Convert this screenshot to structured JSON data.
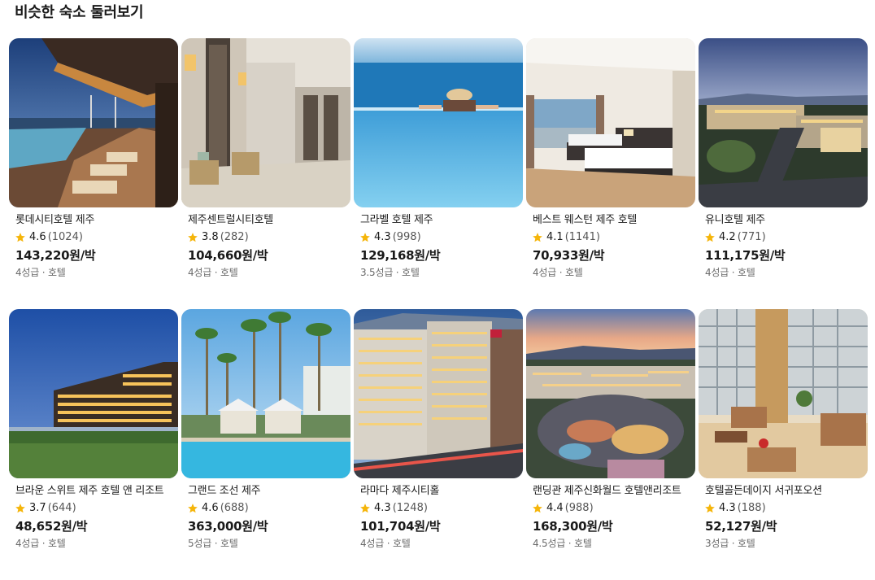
{
  "section": {
    "title": "비슷한 숙소 둘러보기"
  },
  "accent": {
    "star_color": "#f5b50a"
  },
  "hotels": [
    {
      "name": "롯데시티호텔 제주",
      "score": "4.6",
      "count": "(1024)",
      "price": "143,220원/박",
      "meta": "4성급 · 호텔",
      "photo": "rooftop-pool-night"
    },
    {
      "name": "제주센트럴시티호텔",
      "score": "3.8",
      "count": "(282)",
      "price": "104,660원/박",
      "meta": "4성급 · 호텔",
      "photo": "hotel-lobby-hallway"
    },
    {
      "name": "그라벨 호텔 제주",
      "score": "4.3",
      "count": "(998)",
      "price": "129,168원/박",
      "meta": "3.5성급 · 호텔",
      "photo": "infinity-pool-sea"
    },
    {
      "name": "베스트 웨스턴 제주 호텔",
      "score": "4.1",
      "count": "(1141)",
      "price": "70,933원/박",
      "meta": "4성급 · 호텔",
      "photo": "twin-bedroom"
    },
    {
      "name": "유니호텔 제주",
      "score": "4.2",
      "count": "(771)",
      "price": "111,175원/박",
      "meta": "4성급 · 호텔",
      "photo": "aerial-resort-dusk"
    },
    {
      "name": "브라운 스위트 제주 호텔 앤 리조트",
      "score": "3.7",
      "count": "(644)",
      "price": "48,652원/박",
      "meta": "4성급 · 호텔",
      "photo": "hotel-exterior-night"
    },
    {
      "name": "그랜드 조선 제주",
      "score": "4.6",
      "count": "(688)",
      "price": "363,000원/박",
      "meta": "5성급 · 호텔",
      "photo": "palm-pool-cabanas"
    },
    {
      "name": "라마다 제주시티홀",
      "score": "4.3",
      "count": "(1248)",
      "price": "101,704원/박",
      "meta": "4성급 · 호텔",
      "photo": "city-hotel-tower"
    },
    {
      "name": "랜딩관 제주신화월드 호텔앤리조트",
      "score": "4.4",
      "count": "(988)",
      "price": "168,300원/박",
      "meta": "4.5성급 · 호텔",
      "photo": "theme-park-aerial"
    },
    {
      "name": "호텔골든데이지 서귀포오션",
      "score": "4.3",
      "count": "(188)",
      "price": "52,127원/박",
      "meta": "3성급 · 호텔",
      "photo": "atrium-lounge"
    }
  ]
}
